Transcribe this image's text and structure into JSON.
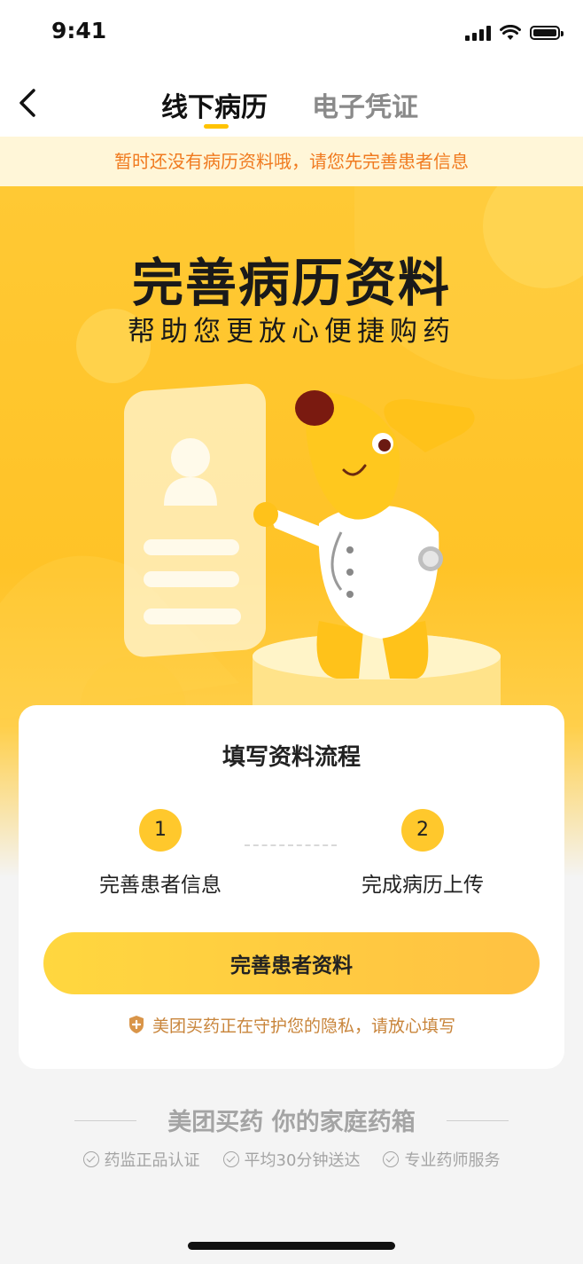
{
  "status_bar": {
    "time": "9:41",
    "icons": [
      "signal-icon",
      "wifi-icon",
      "battery-icon"
    ]
  },
  "nav": {
    "back_icon": "chevron-left-icon",
    "tabs": [
      {
        "label": "线下病历",
        "active": true
      },
      {
        "label": "电子凭证",
        "active": false
      }
    ]
  },
  "notice": {
    "text": "暂时还没有病历资料哦，请您先完善患者信息"
  },
  "hero": {
    "title": "完善病历资料",
    "subtitle": "帮助您更放心便捷购药",
    "illustration": "mascot-doctor-dog-with-record-card"
  },
  "process_card": {
    "title": "填写资料流程",
    "steps": [
      {
        "number": "1",
        "label": "完善患者信息"
      },
      {
        "number": "2",
        "label": "完成病历上传"
      }
    ],
    "cta_label": "完善患者资料",
    "privacy_text": "美团买药正在守护您的隐私，请放心填写"
  },
  "footer": {
    "slogan": "美团买药 你的家庭药箱",
    "features": [
      "药监正品认证",
      "平均30分钟送达",
      "专业药师服务"
    ]
  },
  "colors": {
    "accent": "#ffc82c",
    "notice_text": "#f07a1f",
    "privacy_text": "#c8843a"
  }
}
